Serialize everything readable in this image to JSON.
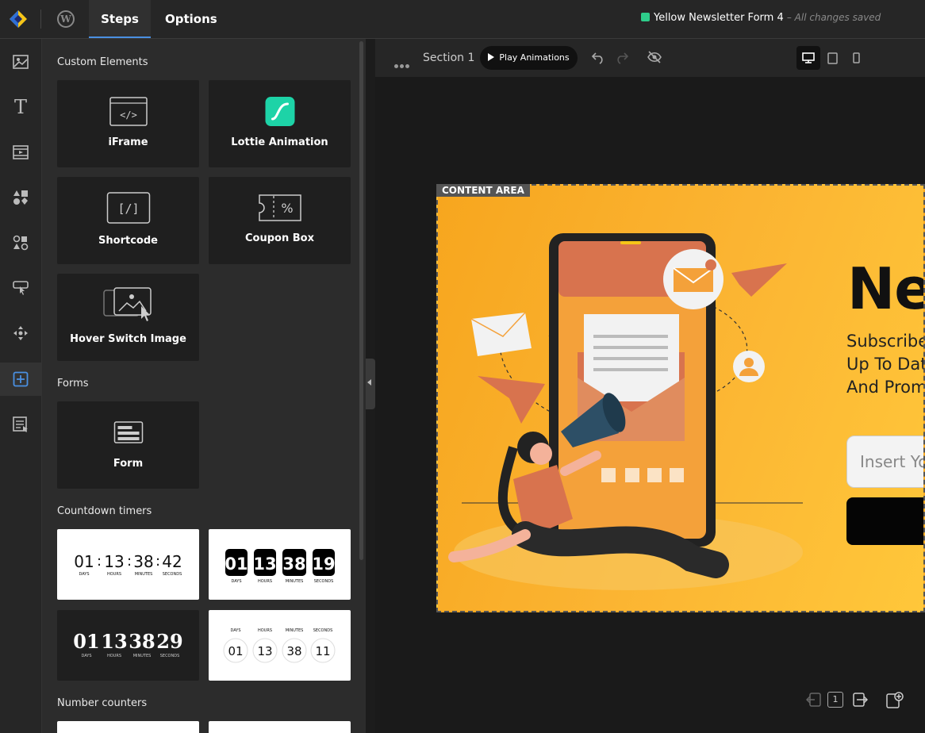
{
  "topbar": {
    "tabs": [
      "Steps",
      "Options"
    ],
    "form_title": "Yellow Newsletter Form 4",
    "saved_status": "– All changes saved"
  },
  "panel": {
    "custom_elements_title": "Custom Elements",
    "custom_elements": [
      "iFrame",
      "Lottie Animation",
      "Shortcode",
      "Coupon Box",
      "Hover Switch Image"
    ],
    "forms_title": "Forms",
    "forms": [
      "Form"
    ],
    "countdown_title": "Countdown timers",
    "timer_units": [
      "DAYS",
      "HOURS",
      "MINUTES",
      "SECONDS"
    ],
    "timers": [
      {
        "values": [
          "01",
          "13",
          "38",
          "42"
        ]
      },
      {
        "values": [
          "01",
          "13",
          "38",
          "19"
        ]
      },
      {
        "values": [
          "01",
          "13",
          "38",
          "29"
        ]
      },
      {
        "values": [
          "01",
          "13",
          "38",
          "11"
        ]
      }
    ],
    "counters_title": "Number counters"
  },
  "toolbar": {
    "section_label": "Section 1",
    "play_label": "Play Animations"
  },
  "canvas": {
    "content_area_label": "CONTENT AREA",
    "headline": "Ne",
    "subtext": [
      "Subscribe",
      "Up To Dat",
      "And Prom"
    ],
    "email_placeholder": "Insert Yo"
  },
  "colors": {
    "accent": "#4a90e2",
    "lottie_green": "#1dd3a7",
    "canvas_yellow": "#fbb432",
    "status_green": "#2ecc8a"
  },
  "icons": {
    "leftbar": [
      "image-icon",
      "text-icon",
      "video-icon",
      "shapes-icon",
      "elements-icon",
      "button-icon",
      "move-icon",
      "add-element-icon",
      "form-icon"
    ],
    "pager": "1"
  }
}
